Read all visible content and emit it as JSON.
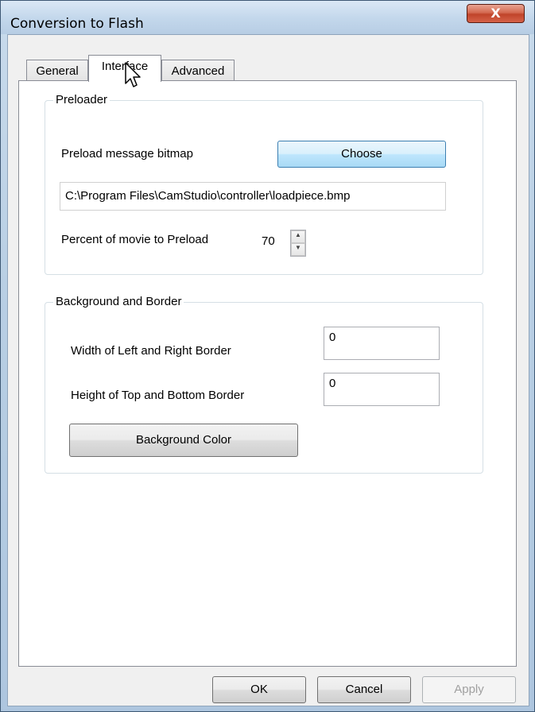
{
  "window": {
    "title": "Conversion to Flash",
    "close_label": "X"
  },
  "tabs": [
    {
      "label": "General"
    },
    {
      "label": "Interface"
    },
    {
      "label": "Advanced"
    }
  ],
  "preloader": {
    "group_label": "Preloader",
    "bitmap_label": "Preload message bitmap",
    "choose_label": "Choose",
    "path_value": "C:\\Program Files\\CamStudio\\controller\\loadpiece.bmp",
    "percent_label": "Percent of movie to Preload",
    "percent_value": "70"
  },
  "background": {
    "group_label": "Background and Border",
    "width_label": "Width of Left and Right Border",
    "width_value": "0",
    "height_label": "Height of Top and Bottom Border",
    "height_value": "0",
    "color_button_label": "Background Color"
  },
  "footer": {
    "ok_label": "OK",
    "cancel_label": "Cancel",
    "apply_label": "Apply"
  },
  "icons": {
    "close": "close-icon",
    "spin_up": "spin-up-icon",
    "spin_down": "spin-down-icon",
    "cursor": "mouse-cursor-icon"
  }
}
